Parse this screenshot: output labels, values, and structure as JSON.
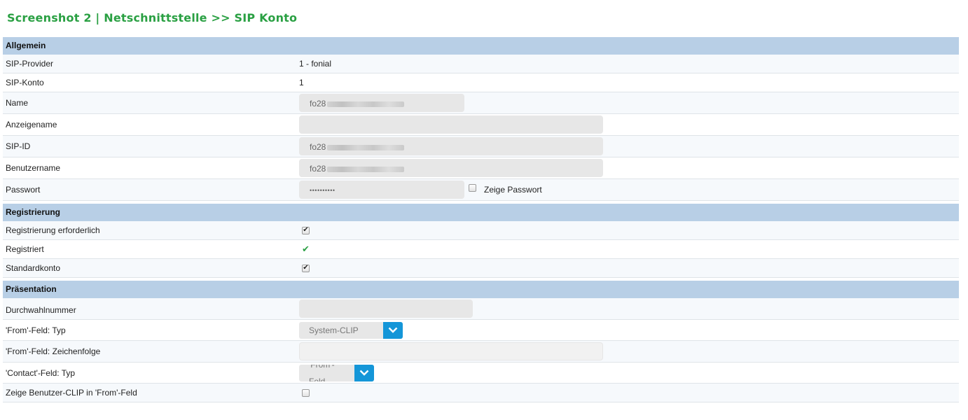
{
  "page": {
    "title": "Screenshot 2 | Netschnittstelle >> SIP Konto"
  },
  "sections": {
    "allgemein": "Allgemein",
    "registrierung": "Registrierung",
    "praesentation": "Präsentation"
  },
  "allgemein": {
    "sip_provider": {
      "label": "SIP-Provider",
      "value": "1 - fonial"
    },
    "sip_konto": {
      "label": "SIP-Konto",
      "value": "1"
    },
    "name": {
      "label": "Name",
      "value": "fo28"
    },
    "anzeigename": {
      "label": "Anzeigename",
      "value": ""
    },
    "sip_id": {
      "label": "SIP-ID",
      "value": "fo28"
    },
    "benutzername": {
      "label": "Benutzername",
      "value": "fo28"
    },
    "passwort": {
      "label": "Passwort",
      "value": "••••••••••",
      "show_label": "Zeige Passwort",
      "show_checked": false
    }
  },
  "registrierung": {
    "erforderlich": {
      "label": "Registrierung erforderlich",
      "checked": true
    },
    "registriert": {
      "label": "Registriert",
      "status": "check-icon"
    },
    "standardkonto": {
      "label": "Standardkonto",
      "checked": true
    }
  },
  "praesentation": {
    "durchwahl": {
      "label": "Durchwahlnummer",
      "value": ""
    },
    "from_typ": {
      "label": "'From'-Feld: Typ",
      "selected": "System-CLIP"
    },
    "from_zeichenfolge": {
      "label": "'From'-Feld: Zeichenfolge",
      "value": ""
    },
    "contact_typ": {
      "label": "'Contact'-Feld: Typ",
      "selected": "'From'-Feld"
    },
    "benutzer_clip": {
      "label": "Zeige Benutzer-CLIP in 'From'-Feld",
      "checked": false
    }
  },
  "colors": {
    "title": "#2aa043",
    "section": "#b8cfe6",
    "select_button": "#1496d8",
    "ok": "#2aa043"
  }
}
